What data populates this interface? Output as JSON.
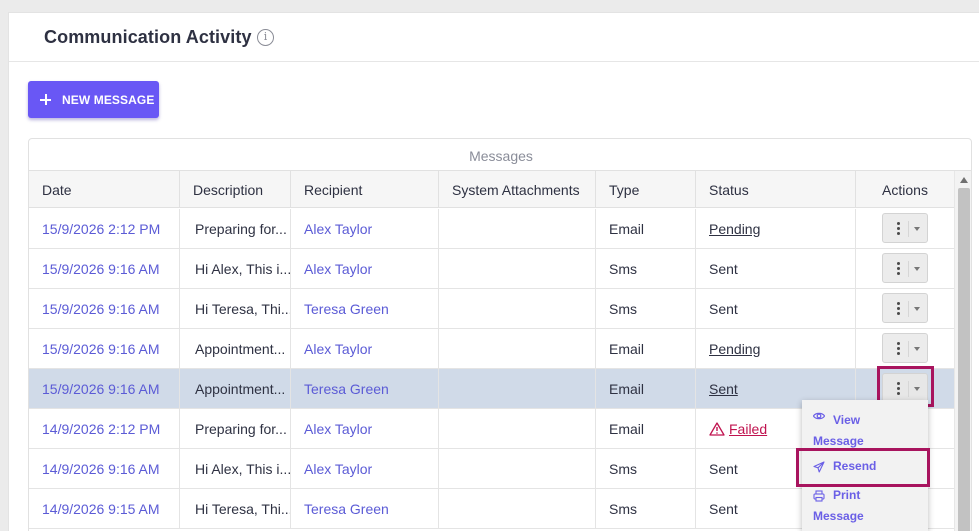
{
  "header": {
    "title": "Communication Activity",
    "info_icon": "info-icon"
  },
  "toolbar": {
    "new_message_label": "NEW MESSAGE",
    "new_message_icon": "plus-icon"
  },
  "grid": {
    "caption": "Messages",
    "columns": [
      "Date",
      "Description",
      "Recipient",
      "System Attachments",
      "Type",
      "Status",
      "Actions"
    ],
    "rows": [
      {
        "date": "15/9/2026 2:12 PM",
        "description": "Preparing for...",
        "recipient": "Alex Taylor",
        "attachments": "",
        "type": "Email",
        "status": "Pending",
        "status_style": "underline"
      },
      {
        "date": "15/9/2026 9:16 AM",
        "description": "Hi Alex, This i...",
        "recipient": "Alex Taylor",
        "attachments": "",
        "type": "Sms",
        "status": "Sent",
        "status_style": "plain"
      },
      {
        "date": "15/9/2026 9:16 AM",
        "description": "Hi Teresa, Thi...",
        "recipient": "Teresa Green",
        "attachments": "",
        "type": "Sms",
        "status": "Sent",
        "status_style": "plain"
      },
      {
        "date": "15/9/2026 9:16 AM",
        "description": "Appointment...",
        "recipient": "Alex Taylor",
        "attachments": "",
        "type": "Email",
        "status": "Pending",
        "status_style": "underline"
      },
      {
        "date": "15/9/2026 9:16 AM",
        "description": "Appointment...",
        "recipient": "Teresa Green",
        "attachments": "",
        "type": "Email",
        "status": "Sent",
        "status_style": "underline",
        "selected": true
      },
      {
        "date": "14/9/2026 2:12 PM",
        "description": "Preparing for...",
        "recipient": "Alex Taylor",
        "attachments": "",
        "type": "Email",
        "status": "Failed",
        "status_style": "failed"
      },
      {
        "date": "14/9/2026 9:16 AM",
        "description": "Hi Alex, This i...",
        "recipient": "Alex Taylor",
        "attachments": "",
        "type": "Sms",
        "status": "Sent",
        "status_style": "plain"
      },
      {
        "date": "14/9/2026 9:15 AM",
        "description": "Hi Teresa, Thi...",
        "recipient": "Teresa Green",
        "attachments": "",
        "type": "Sms",
        "status": "Sent",
        "status_style": "plain"
      }
    ]
  },
  "actions_menu": {
    "items": [
      {
        "label_line1": "View",
        "label_line2": "Message",
        "icon": "eye-icon"
      },
      {
        "label_line1": "Resend",
        "label_line2": "",
        "icon": "send-icon"
      },
      {
        "label_line1": "Print",
        "label_line2": "Message",
        "icon": "printer-icon"
      }
    ]
  },
  "colors": {
    "accent": "#6957f5",
    "link": "#5b5bd6",
    "failed": "#c0134f",
    "highlight_border": "#a8145e",
    "selected_row": "#d0dae8"
  }
}
